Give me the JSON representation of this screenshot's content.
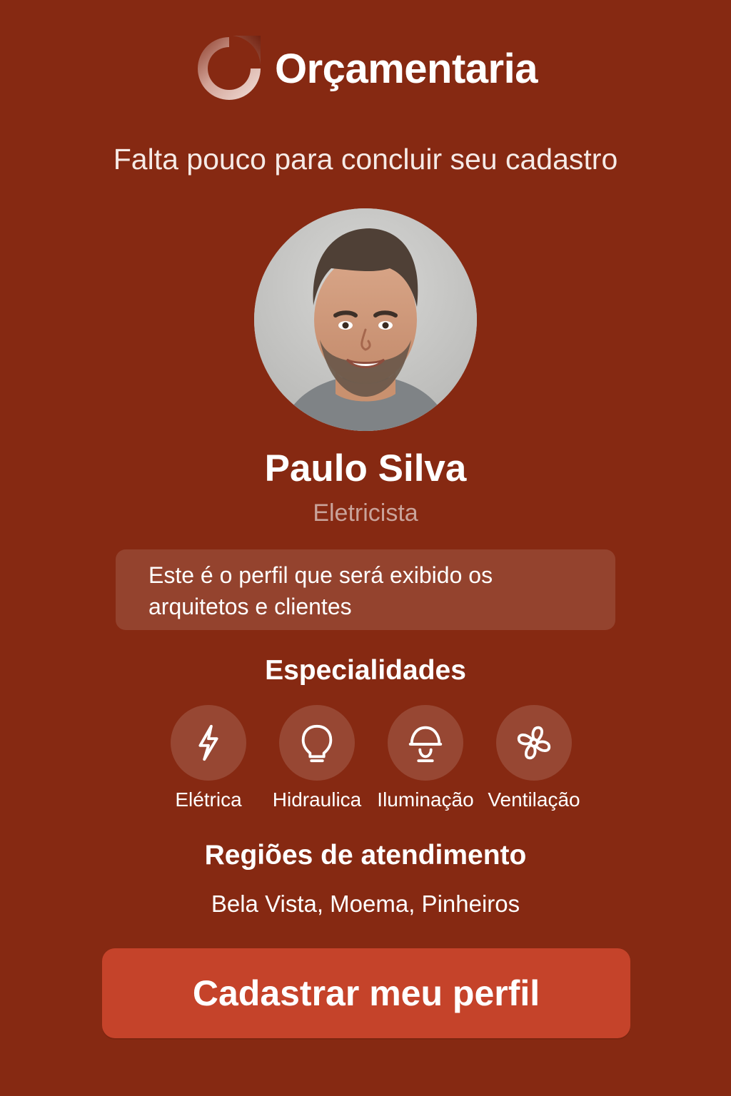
{
  "brand": {
    "name": "Orçamentaria"
  },
  "headline": "Falta pouco para concluir seu cadastro",
  "profile": {
    "name": "Paulo Silva",
    "role": "Eletricista"
  },
  "notice": {
    "line1": "Este é o perfil que será exibido os",
    "line2": "arquitetos e clientes"
  },
  "specialties": {
    "title": "Especialidades",
    "items": [
      {
        "label": "Elétrica",
        "icon": "lightning-icon"
      },
      {
        "label": "Hidraulica",
        "icon": "lightbulb-icon"
      },
      {
        "label": "Iluminação",
        "icon": "ceiling-lamp-icon"
      },
      {
        "label": "Ventilação",
        "icon": "fan-icon"
      }
    ]
  },
  "regions": {
    "title": "Regiões de atendimento",
    "list": "Bela Vista, Moema, Pinheiros"
  },
  "cta": {
    "label": "Cadastrar meu perfil"
  },
  "colors": {
    "background": "#862912",
    "button": "#c5432a",
    "role_text": "#c9a39a",
    "text": "#ffffff"
  }
}
